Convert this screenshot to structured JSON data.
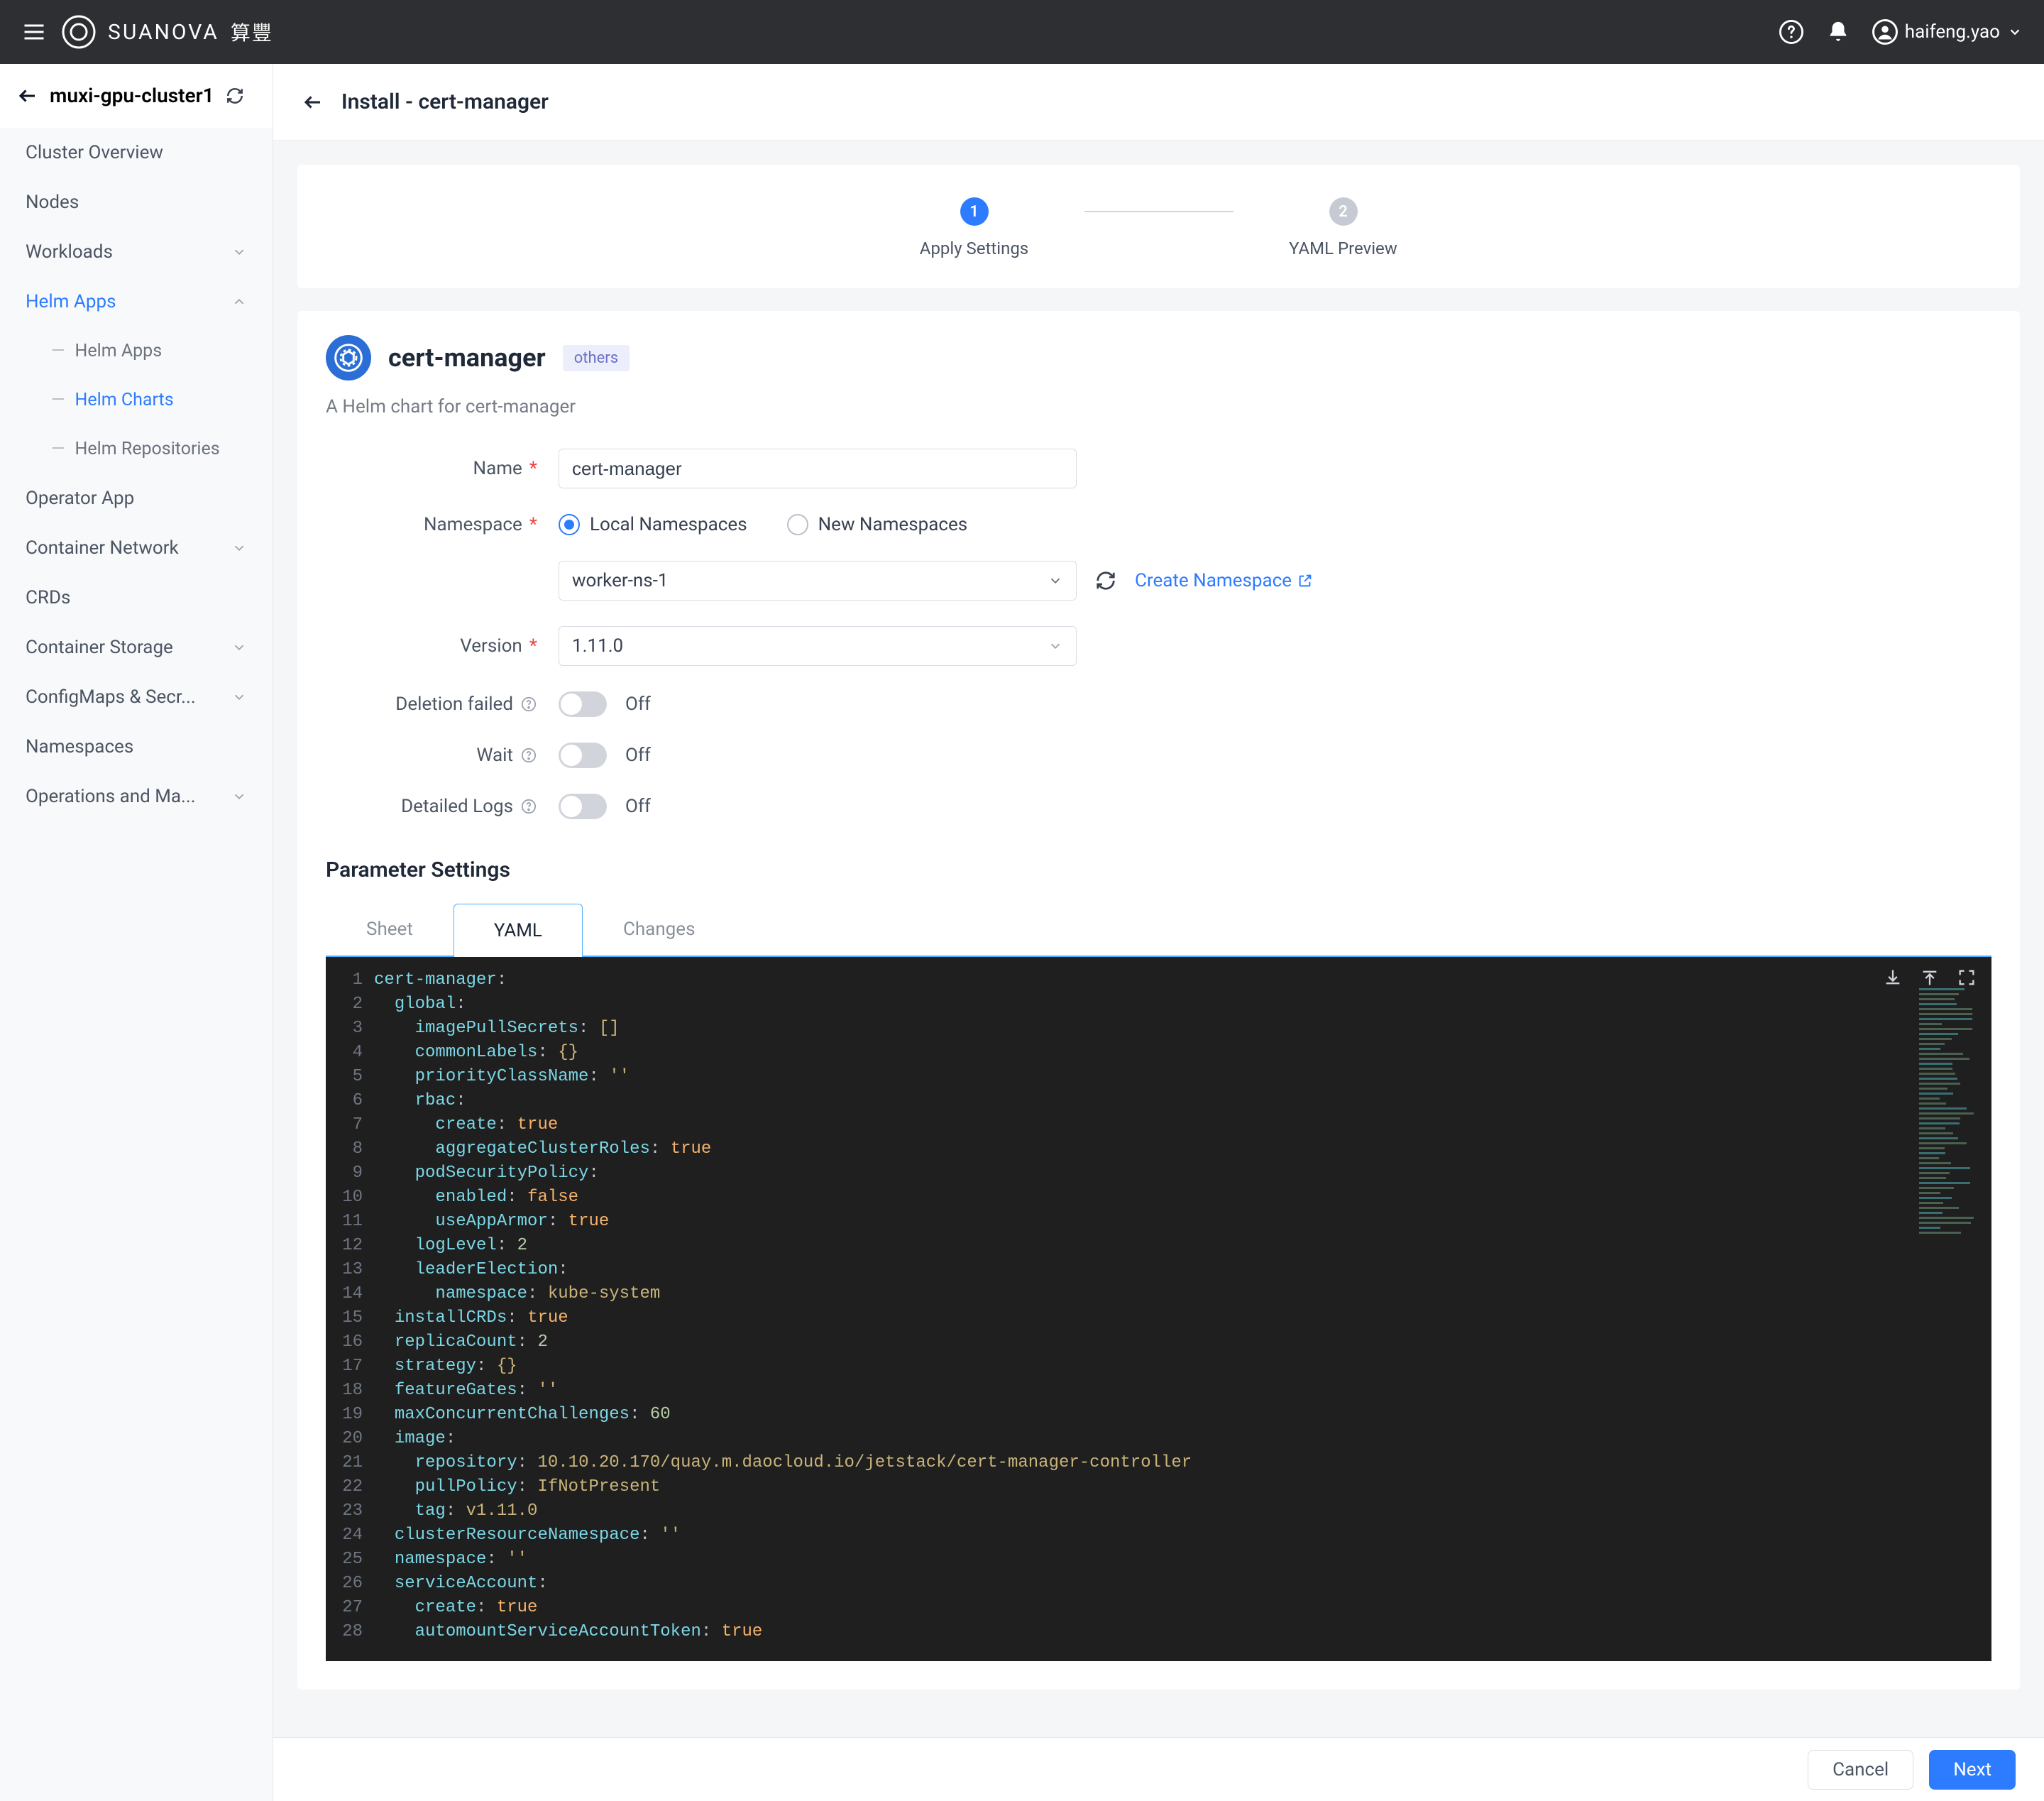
{
  "brand": {
    "name": "SUANOVA",
    "sub": "算豐"
  },
  "user": {
    "name": "haifeng.yao"
  },
  "sidebar": {
    "cluster": "muxi-gpu-cluster1",
    "items": [
      {
        "label": "Cluster Overview",
        "expandable": false
      },
      {
        "label": "Nodes",
        "expandable": false
      },
      {
        "label": "Workloads",
        "expandable": true
      },
      {
        "label": "Helm Apps",
        "expandable": true,
        "active": true,
        "expanded": true
      },
      {
        "label": "Operator App",
        "expandable": false
      },
      {
        "label": "Container Network",
        "expandable": true
      },
      {
        "label": "CRDs",
        "expandable": false
      },
      {
        "label": "Container Storage",
        "expandable": true
      },
      {
        "label": "ConfigMaps & Secr...",
        "expandable": true
      },
      {
        "label": "Namespaces",
        "expandable": false
      },
      {
        "label": "Operations and Ma...",
        "expandable": true
      }
    ],
    "subitems": [
      {
        "label": "Helm Apps"
      },
      {
        "label": "Helm Charts",
        "active": true
      },
      {
        "label": "Helm Repositories"
      }
    ]
  },
  "page": {
    "title": "Install - cert-manager"
  },
  "steps": [
    {
      "num": "1",
      "label": "Apply Settings",
      "state": "active"
    },
    {
      "num": "2",
      "label": "YAML Preview",
      "state": "pending"
    }
  ],
  "app": {
    "title": "cert-manager",
    "tag": "others",
    "desc": "A Helm chart for cert-manager"
  },
  "form": {
    "name_label": "Name",
    "name_value": "cert-manager",
    "namespace_label": "Namespace",
    "ns_local": "Local Namespaces",
    "ns_new": "New Namespaces",
    "ns_selected": "worker-ns-1",
    "create_ns": "Create Namespace",
    "version_label": "Version",
    "version_value": "1.11.0",
    "deletion_label": "Deletion failed",
    "wait_label": "Wait",
    "logs_label": "Detailed Logs",
    "off": "Off"
  },
  "params": {
    "title": "Parameter Settings",
    "tabs": [
      "Sheet",
      "YAML",
      "Changes"
    ],
    "active_tab": 1
  },
  "yaml_lines": [
    [
      [
        "key",
        "cert-manager"
      ],
      [
        "punc",
        ":"
      ]
    ],
    [
      [
        "sp",
        "  "
      ],
      [
        "key",
        "global"
      ],
      [
        "punc",
        ":"
      ]
    ],
    [
      [
        "sp",
        "    "
      ],
      [
        "key",
        "imagePullSecrets"
      ],
      [
        "punc",
        ": "
      ],
      [
        "str",
        "[]"
      ]
    ],
    [
      [
        "sp",
        "    "
      ],
      [
        "key",
        "commonLabels"
      ],
      [
        "punc",
        ": "
      ],
      [
        "str",
        "{}"
      ]
    ],
    [
      [
        "sp",
        "    "
      ],
      [
        "key",
        "priorityClassName"
      ],
      [
        "punc",
        ": "
      ],
      [
        "str",
        "''"
      ]
    ],
    [
      [
        "sp",
        "    "
      ],
      [
        "key",
        "rbac"
      ],
      [
        "punc",
        ":"
      ]
    ],
    [
      [
        "sp",
        "      "
      ],
      [
        "key",
        "create"
      ],
      [
        "punc",
        ": "
      ],
      [
        "bool",
        "true"
      ]
    ],
    [
      [
        "sp",
        "      "
      ],
      [
        "key",
        "aggregateClusterRoles"
      ],
      [
        "punc",
        ": "
      ],
      [
        "bool",
        "true"
      ]
    ],
    [
      [
        "sp",
        "    "
      ],
      [
        "key",
        "podSecurityPolicy"
      ],
      [
        "punc",
        ":"
      ]
    ],
    [
      [
        "sp",
        "      "
      ],
      [
        "key",
        "enabled"
      ],
      [
        "punc",
        ": "
      ],
      [
        "bool",
        "false"
      ]
    ],
    [
      [
        "sp",
        "      "
      ],
      [
        "key",
        "useAppArmor"
      ],
      [
        "punc",
        ": "
      ],
      [
        "bool",
        "true"
      ]
    ],
    [
      [
        "sp",
        "    "
      ],
      [
        "key",
        "logLevel"
      ],
      [
        "punc",
        ": "
      ],
      [
        "num",
        "2"
      ]
    ],
    [
      [
        "sp",
        "    "
      ],
      [
        "key",
        "leaderElection"
      ],
      [
        "punc",
        ":"
      ]
    ],
    [
      [
        "sp",
        "      "
      ],
      [
        "key",
        "namespace"
      ],
      [
        "punc",
        ": "
      ],
      [
        "str",
        "kube-system"
      ]
    ],
    [
      [
        "sp",
        "  "
      ],
      [
        "key",
        "installCRDs"
      ],
      [
        "punc",
        ": "
      ],
      [
        "bool",
        "true"
      ]
    ],
    [
      [
        "sp",
        "  "
      ],
      [
        "key",
        "replicaCount"
      ],
      [
        "punc",
        ": "
      ],
      [
        "num",
        "2"
      ]
    ],
    [
      [
        "sp",
        "  "
      ],
      [
        "key",
        "strategy"
      ],
      [
        "punc",
        ": "
      ],
      [
        "str",
        "{}"
      ]
    ],
    [
      [
        "sp",
        "  "
      ],
      [
        "key",
        "featureGates"
      ],
      [
        "punc",
        ": "
      ],
      [
        "str",
        "''"
      ]
    ],
    [
      [
        "sp",
        "  "
      ],
      [
        "key",
        "maxConcurrentChallenges"
      ],
      [
        "punc",
        ": "
      ],
      [
        "num",
        "60"
      ]
    ],
    [
      [
        "sp",
        "  "
      ],
      [
        "key",
        "image"
      ],
      [
        "punc",
        ":"
      ]
    ],
    [
      [
        "sp",
        "    "
      ],
      [
        "key",
        "repository"
      ],
      [
        "punc",
        ": "
      ],
      [
        "str",
        "10.10.20.170/quay.m.daocloud.io/jetstack/cert-manager-controller"
      ]
    ],
    [
      [
        "sp",
        "    "
      ],
      [
        "key",
        "pullPolicy"
      ],
      [
        "punc",
        ": "
      ],
      [
        "str",
        "IfNotPresent"
      ]
    ],
    [
      [
        "sp",
        "    "
      ],
      [
        "key",
        "tag"
      ],
      [
        "punc",
        ": "
      ],
      [
        "str",
        "v1.11.0"
      ]
    ],
    [
      [
        "sp",
        "  "
      ],
      [
        "key",
        "clusterResourceNamespace"
      ],
      [
        "punc",
        ": "
      ],
      [
        "str",
        "''"
      ]
    ],
    [
      [
        "sp",
        "  "
      ],
      [
        "key",
        "namespace"
      ],
      [
        "punc",
        ": "
      ],
      [
        "str",
        "''"
      ]
    ],
    [
      [
        "sp",
        "  "
      ],
      [
        "key",
        "serviceAccount"
      ],
      [
        "punc",
        ":"
      ]
    ],
    [
      [
        "sp",
        "    "
      ],
      [
        "key",
        "create"
      ],
      [
        "punc",
        ": "
      ],
      [
        "bool",
        "true"
      ]
    ],
    [
      [
        "sp",
        "    "
      ],
      [
        "key",
        "automountServiceAccountToken"
      ],
      [
        "punc",
        ": "
      ],
      [
        "bool",
        "true"
      ]
    ]
  ],
  "footer": {
    "cancel": "Cancel",
    "next": "Next"
  }
}
